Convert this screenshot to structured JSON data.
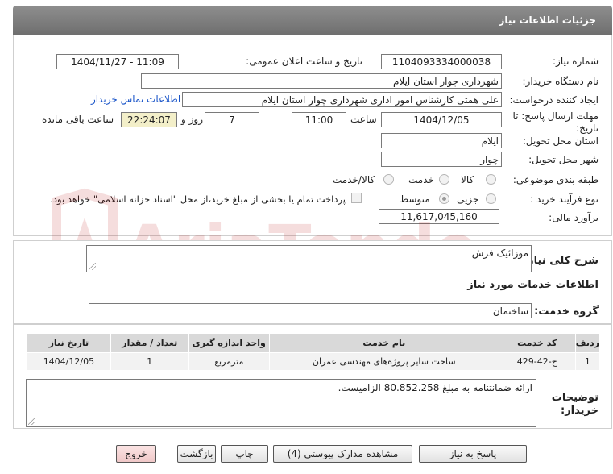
{
  "header": {
    "title": "جزئیات اطلاعات نیاز"
  },
  "form": {
    "need_number_label": "شماره نیاز:",
    "need_number": "1104093334000038",
    "announce_label": "تاریخ و ساعت اعلان عمومی:",
    "announce_value": "1404/11/27 - 11:09",
    "buyer_org_label": "نام دستگاه خریدار:",
    "buyer_org": "شهرداری چوار استان ایلام",
    "requester_label": "ایجاد کننده درخواست:",
    "requester": "علی  همتی  کارشناس امور اداری  شهرداری چوار استان ایلام",
    "contact_link": "اطلاعات تماس خریدار",
    "deadline_label": "مهلت ارسال پاسخ: تا تاریخ:",
    "deadline_date": "1404/12/05",
    "time_label": "ساعت",
    "deadline_time": "11:00",
    "days": "7",
    "days_label": "روز و",
    "remaining_time": "22:24:07",
    "remaining_label": "ساعت باقی مانده",
    "province_label": "استان محل تحویل:",
    "province": "ایلام",
    "city_label": "شهر محل تحویل:",
    "city": "چوار",
    "category_label": "طبقه بندی موضوعی:",
    "category_options": [
      "کالا",
      "خدمت",
      "کالا/خدمت"
    ],
    "category_selected": "خدمت",
    "purchase_type_label": "نوع فرآیند خرید :",
    "purchase_options": [
      "جزیی",
      "متوسط"
    ],
    "purchase_selected": "متوسط",
    "payment_note": "پرداخت تمام یا بخشی از مبلغ خرید،از محل \"اسناد خزانه اسلامی\" خواهد بود.",
    "estimate_label": "برآورد مالی:",
    "estimate": "11,617,045,160"
  },
  "description": {
    "label": "شرح کلی نیاز:",
    "value": "موزائیک فرش"
  },
  "services": {
    "section_title": "اطلاعات خدمات مورد نیاز",
    "group_label": "گروه خدمت:",
    "group_value": "ساختمان",
    "table": {
      "headers": [
        "ردیف",
        "کد خدمت",
        "نام خدمت",
        "واحد اندازه گیری",
        "تعداد / مقدار",
        "تاریخ نیاز"
      ],
      "rows": [
        [
          "1",
          "ج-42-429",
          "ساخت سایر پروژه‌های مهندسی عمران",
          "مترمربع",
          "1",
          "1404/12/05"
        ]
      ]
    }
  },
  "buyer_notes": {
    "label": "توضیحات خریدار:",
    "value": "ارائه ضمانتنامه به مبلغ 80.852.258 الزامیست."
  },
  "buttons": {
    "reply": "پاسخ به نیاز",
    "attachments": "مشاهده مدارک پیوستی (4)",
    "print": "چاپ",
    "back": "بازگشت",
    "exit": "خروج"
  },
  "watermark": {
    "text": "AriaTender.neT"
  },
  "colors": {
    "title_bar": "#7a7a7a",
    "link": "#1a55c9",
    "remaining_bg": "#f3efc9",
    "exit_bg": "#f0c8c8"
  }
}
